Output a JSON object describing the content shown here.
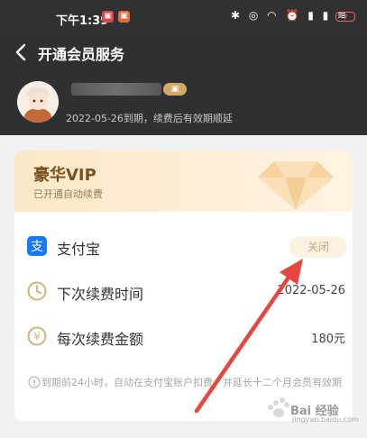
{
  "status_bar": {
    "time": "下午1:39",
    "icons": "✱ ◎ ◠ ⏰ ▮ ▮ ≋",
    "battery": "7"
  },
  "header": {
    "title": "开通会员服务",
    "vip_tag": "▣",
    "expire_text": "2022-05-26到期，续费后有效期顺延"
  },
  "card": {
    "vip_title": "豪华VIP",
    "vip_subtitle": "已开通自动续费",
    "rows": [
      {
        "label": "支付宝",
        "action": "关闭"
      },
      {
        "label": "下次续费时间",
        "value": "2022-05-26"
      },
      {
        "label": "每次续费金额",
        "value": "180元"
      }
    ],
    "notice": "到期前24小时，自动在支付宝账户扣费，并延长十二个月会员有效期"
  },
  "watermark": {
    "brand": "Bai 经验",
    "url": "jingyan.baidu.com"
  },
  "colors": {
    "header_bg": "#2f3032",
    "vip_gold": "#7a5221",
    "alipay_blue": "#1677ff",
    "arrow_red": "#e8453c"
  }
}
